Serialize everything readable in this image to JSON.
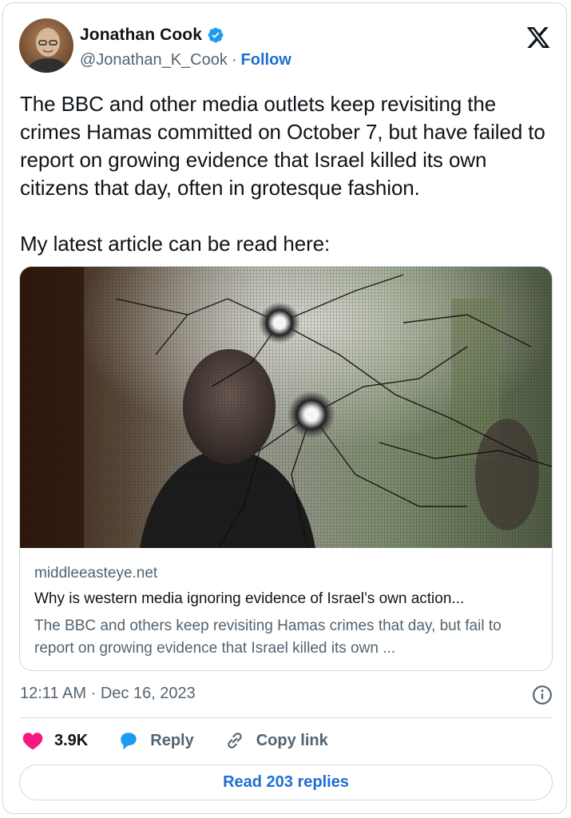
{
  "author": {
    "name": "Jonathan Cook",
    "handle": "@Jonathan_K_Cook",
    "separator": "·",
    "follow_label": "Follow"
  },
  "tweet": {
    "text": "The BBC and other media outlets keep revisiting the crimes Hamas committed on October 7, but have failed to report on growing evidence that Israel killed its own citizens that day, often in grotesque fashion.\n\nMy latest article can be read here:"
  },
  "link_card": {
    "domain": "middleeasteye.net",
    "title": "Why is western media ignoring evidence of Israel’s own action...",
    "description": "The BBC and others keep revisiting Hamas crimes that day, but fail to report on growing evidence that Israel killed its own ..."
  },
  "meta": {
    "time": "12:11 AM",
    "separator": "·",
    "date": "Dec 16, 2023"
  },
  "actions": {
    "like_count": "3.9K",
    "reply_label": "Reply",
    "copy_link_label": "Copy link"
  },
  "read_replies_label": "Read 203 replies",
  "colors": {
    "accent": "#1d6fd1",
    "like": "#f91880",
    "reply": "#1d9bf0",
    "secondary_text": "#536471",
    "border": "#cfd9de"
  },
  "icons": [
    "verified-badge-icon",
    "x-logo-icon",
    "info-icon",
    "heart-icon",
    "reply-bubble-icon",
    "link-icon"
  ]
}
